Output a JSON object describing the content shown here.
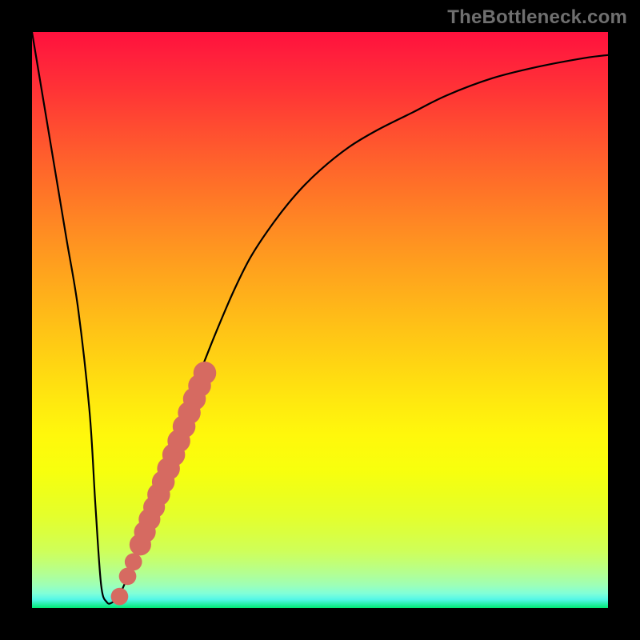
{
  "watermark": "TheBottleneck.com",
  "colors": {
    "background": "#000000",
    "curve": "#000000",
    "markers": "#d66a61",
    "watermark": "#6f6f6f"
  },
  "chart_data": {
    "type": "line",
    "title": "",
    "xlabel": "",
    "ylabel": "",
    "xlim": [
      0,
      100
    ],
    "ylim": [
      0,
      100
    ],
    "grid": false,
    "series": [
      {
        "name": "bottleneck-curve",
        "x": [
          0,
          2,
          4,
          6,
          8,
          10,
          11,
          12,
          13,
          14,
          15,
          16,
          18,
          20,
          22,
          24,
          26,
          28,
          30,
          32,
          35,
          38,
          42,
          46,
          50,
          55,
          60,
          66,
          72,
          80,
          88,
          96,
          100
        ],
        "y": [
          100,
          88,
          76,
          64,
          52,
          34,
          18,
          4,
          1,
          1,
          2,
          4,
          9,
          14,
          20,
          26,
          32,
          38,
          43,
          48,
          55,
          61,
          67,
          72,
          76,
          80,
          83,
          86,
          89,
          92,
          94,
          95.5,
          96
        ]
      }
    ],
    "markers": [
      {
        "x": 15.2,
        "y": 2.0,
        "r": 1.0
      },
      {
        "x": 16.6,
        "y": 5.5,
        "r": 1.0
      },
      {
        "x": 17.6,
        "y": 8.0,
        "r": 1.0
      },
      {
        "x": 18.8,
        "y": 11.0,
        "r": 1.4
      },
      {
        "x": 19.6,
        "y": 13.2,
        "r": 1.4
      },
      {
        "x": 20.4,
        "y": 15.4,
        "r": 1.4
      },
      {
        "x": 21.2,
        "y": 17.5,
        "r": 1.4
      },
      {
        "x": 22.0,
        "y": 19.7,
        "r": 1.5
      },
      {
        "x": 22.8,
        "y": 21.9,
        "r": 1.5
      },
      {
        "x": 23.7,
        "y": 24.2,
        "r": 1.5
      },
      {
        "x": 24.6,
        "y": 26.6,
        "r": 1.5
      },
      {
        "x": 25.5,
        "y": 29.0,
        "r": 1.5
      },
      {
        "x": 26.4,
        "y": 31.5,
        "r": 1.5
      },
      {
        "x": 27.3,
        "y": 33.9,
        "r": 1.5
      },
      {
        "x": 28.2,
        "y": 36.3,
        "r": 1.5
      },
      {
        "x": 29.1,
        "y": 38.6,
        "r": 1.5
      },
      {
        "x": 30.0,
        "y": 40.8,
        "r": 1.5
      }
    ]
  }
}
